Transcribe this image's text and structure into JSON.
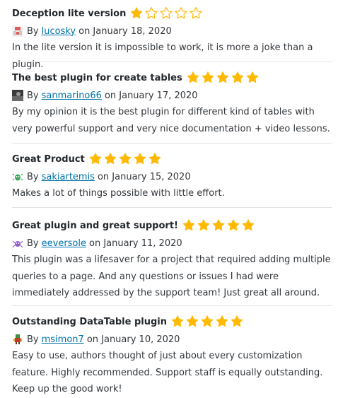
{
  "colors": {
    "star": "#ffb900",
    "link": "#0073aa",
    "divider": "#e2e4e7"
  },
  "reviews": [
    {
      "title": "Deception lite version",
      "rating": 1,
      "by": "By",
      "author": "lucosky",
      "date": "on January 18, 2020",
      "avatar_icon": "identicon-avatar-icon",
      "body": "In the lite version it is impossible to work, it is more a joke than a plugin."
    },
    {
      "title": "The best plugin for create tables",
      "rating": 5,
      "by": "By",
      "author": "sanmarino66",
      "date": "on January 17, 2020",
      "avatar_icon": "photo-avatar-icon",
      "body": "By my opinion it is the best plugin for different kind of tables with very powerful support and very nice documentation + video lessons."
    },
    {
      "title": "Great Product",
      "rating": 5,
      "by": "By",
      "author": "sakiartemis",
      "date": "on January 15, 2020",
      "avatar_icon": "bug-avatar-icon",
      "body": "Makes a lot of things possible with little effort."
    },
    {
      "title": "Great plugin and great support!",
      "rating": 5,
      "by": "By",
      "author": "eeversole",
      "date": "on January 11, 2020",
      "avatar_icon": "spider-avatar-icon",
      "body": "This plugin was a lifesaver for a project that required adding multiple queries to a page. And any questions or issues I had were immediately addressed by the support team! Just great all around."
    },
    {
      "title": "Outstanding DataTable plugin",
      "rating": 5,
      "by": "By",
      "author": "msimon7",
      "date": "on January 10, 2020",
      "avatar_icon": "character-avatar-icon",
      "body": "Easy to use, authors thought of just about every customization feature. Highly recommended. Support staff is equally outstanding. Keep up the good work!"
    }
  ]
}
